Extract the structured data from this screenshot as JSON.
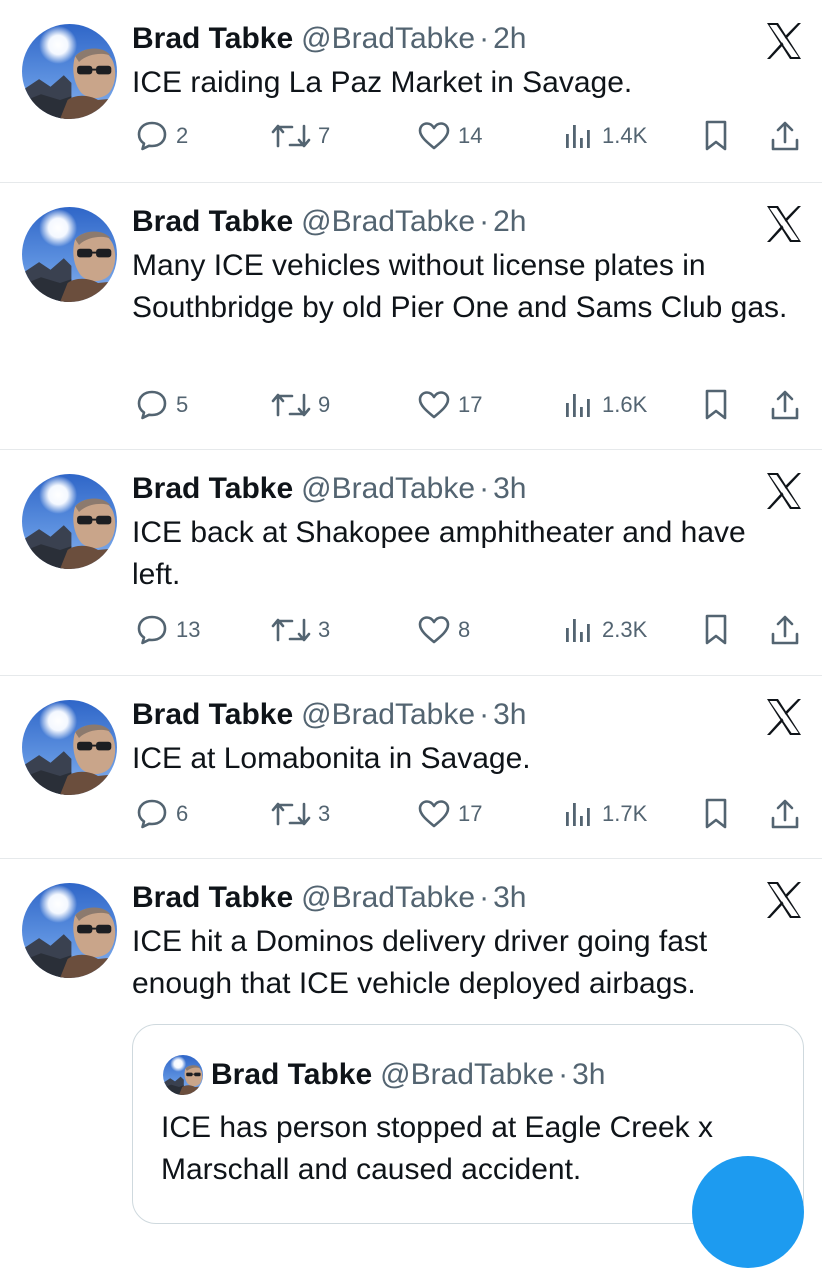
{
  "colors": {
    "text": "#0f1419",
    "secondary": "#536471",
    "divider": "#e6e9eb",
    "accent": "#1d9bf0"
  },
  "icons": {
    "reply": "speech-bubble-icon",
    "retweet": "retweet-arrows-icon",
    "like": "heart-icon",
    "views": "bar-chart-icon",
    "bookmark": "bookmark-icon",
    "share": "share-upload-icon",
    "platform": "x-logo-icon"
  },
  "tweets": [
    {
      "name": "Brad Tabke",
      "handle": "@BradTabke",
      "separator": "·",
      "time": "2h",
      "text": "ICE raiding La Paz Market in Savage.",
      "replies": "2",
      "retweets": "7",
      "likes": "14",
      "views": "1.4K"
    },
    {
      "name": "Brad Tabke",
      "handle": "@BradTabke",
      "separator": "·",
      "time": "2h",
      "text": "Many ICE vehicles without license plates in Southbridge by old Pier One and Sams Club gas.",
      "replies": "5",
      "retweets": "9",
      "likes": "17",
      "views": "1.6K"
    },
    {
      "name": "Brad Tabke",
      "handle": "@BradTabke",
      "separator": "·",
      "time": "3h",
      "text": "ICE back at Shakopee amphitheater and have left.",
      "replies": "13",
      "retweets": "3",
      "likes": "8",
      "views": "2.3K"
    },
    {
      "name": "Brad Tabke",
      "handle": "@BradTabke",
      "separator": "·",
      "time": "3h",
      "text": "ICE at Lomabonita in Savage.",
      "replies": "6",
      "retweets": "3",
      "likes": "17",
      "views": "1.7K"
    },
    {
      "name": "Brad Tabke",
      "handle": "@BradTabke",
      "separator": "·",
      "time": "3h",
      "text": "ICE hit a Dominos delivery driver going fast enough that ICE vehicle deployed airbags.",
      "quote": {
        "name": "Brad Tabke",
        "handle": "@BradTabke",
        "separator": "·",
        "time": "3h",
        "text": "ICE has person stopped at Eagle Creek x Marschall and caused accident."
      }
    }
  ]
}
